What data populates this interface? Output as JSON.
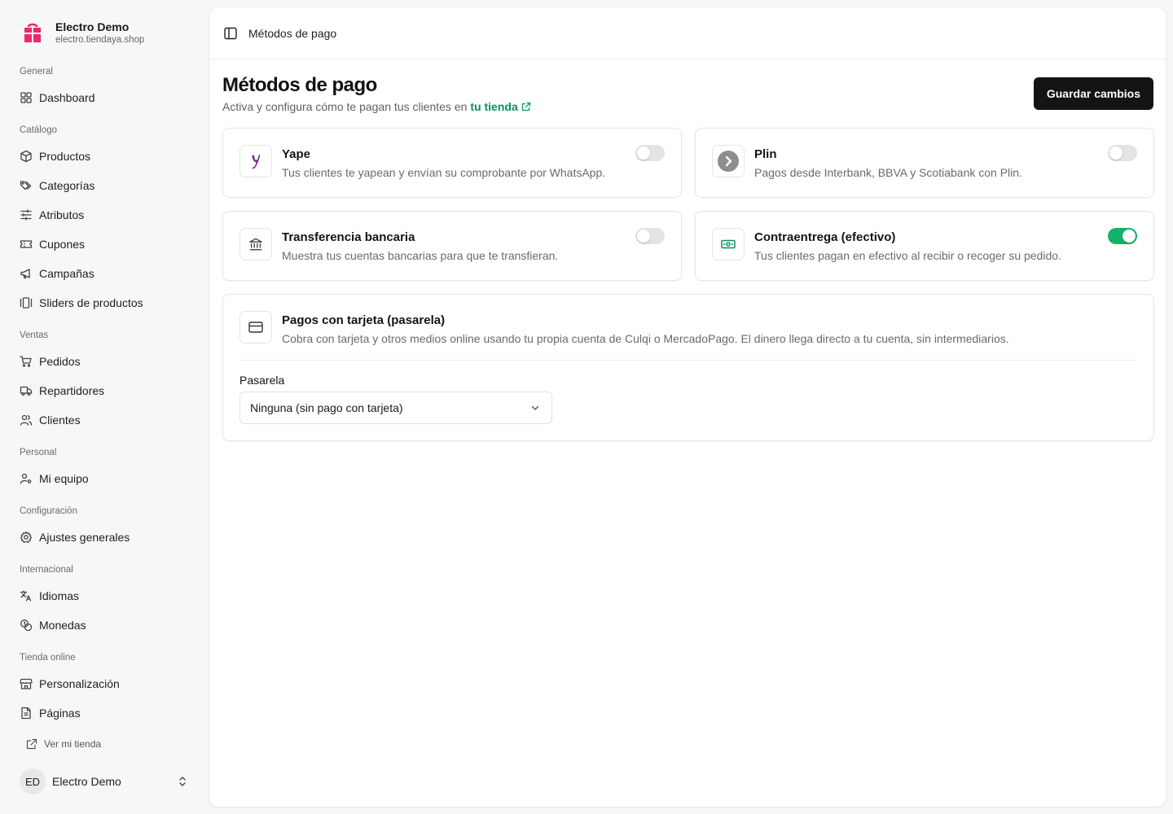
{
  "brand": {
    "name": "Electro Demo",
    "url": "electro.tiendaya.shop",
    "logo_color": "#f0266f"
  },
  "sidebar": {
    "groups": [
      {
        "label": "General",
        "items": [
          {
            "label": "Dashboard",
            "icon": "grid-icon"
          }
        ]
      },
      {
        "label": "Catálogo",
        "items": [
          {
            "label": "Productos",
            "icon": "box-icon"
          },
          {
            "label": "Categorías",
            "icon": "tags-icon"
          },
          {
            "label": "Atributos",
            "icon": "sliders-icon"
          },
          {
            "label": "Cupones",
            "icon": "ticket-icon"
          },
          {
            "label": "Campañas",
            "icon": "megaphone-icon"
          },
          {
            "label": "Sliders de productos",
            "icon": "gallery-icon"
          }
        ]
      },
      {
        "label": "Ventas",
        "items": [
          {
            "label": "Pedidos",
            "icon": "cart-icon"
          },
          {
            "label": "Repartidores",
            "icon": "truck-icon"
          },
          {
            "label": "Clientes",
            "icon": "users-icon"
          }
        ]
      },
      {
        "label": "Personal",
        "items": [
          {
            "label": "Mi equipo",
            "icon": "user-cog-icon"
          }
        ]
      },
      {
        "label": "Configuración",
        "items": [
          {
            "label": "Ajustes generales",
            "icon": "gear-icon"
          }
        ]
      },
      {
        "label": "Internacional",
        "items": [
          {
            "label": "Idiomas",
            "icon": "languages-icon"
          },
          {
            "label": "Monedas",
            "icon": "coins-icon"
          }
        ]
      },
      {
        "label": "Tienda online",
        "items": [
          {
            "label": "Personalización",
            "icon": "store-icon"
          },
          {
            "label": "Páginas",
            "icon": "file-icon"
          }
        ]
      }
    ],
    "store_link": "Ver mi tienda",
    "user": {
      "initials": "ED",
      "name": "Electro Demo"
    }
  },
  "topbar": {
    "breadcrumb": "Métodos de pago"
  },
  "page": {
    "title": "Métodos de pago",
    "subtitle": "Activa y configura cómo te pagan tus clientes en",
    "subtitle_link": "tu tienda",
    "save_label": "Guardar cambios",
    "accent": "#10b36b"
  },
  "methods": [
    {
      "title": "Yape",
      "desc": "Tus clientes te yapean y envían su comprobante por WhatsApp.",
      "enabled": false,
      "icon": "yape-icon"
    },
    {
      "title": "Plin",
      "desc": "Pagos desde Interbank, BBVA y Scotiabank con Plin.",
      "enabled": false,
      "icon": "plin-icon"
    },
    {
      "title": "Transferencia bancaria",
      "desc": "Muestra tus cuentas bancarias para que te transfieran.",
      "enabled": false,
      "icon": "bank-icon"
    },
    {
      "title": "Contraentrega (efectivo)",
      "desc": "Tus clientes pagan en efectivo al recibir o recoger su pedido.",
      "enabled": true,
      "icon": "cash-icon"
    }
  ],
  "gateway": {
    "title": "Pagos con tarjeta (pasarela)",
    "desc": "Cobra con tarjeta y otros medios online usando tu propia cuenta de Culqi o MercadoPago. El dinero llega directo a tu cuenta, sin intermediarios.",
    "field_label": "Pasarela",
    "selected": "Ninguna (sin pago con tarjeta)",
    "icon": "credit-card-icon"
  }
}
